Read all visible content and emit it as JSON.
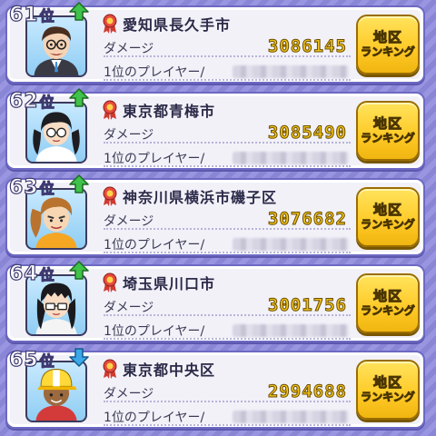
{
  "ranking": {
    "damage_label": "ダメージ",
    "top_player_label": "1位のプレイヤー/",
    "button_line1": "地区",
    "button_line2": "ランキング",
    "rank_suffix": "位",
    "entries": [
      {
        "rank": "61",
        "trend": "up",
        "location": "愛知県長久手市",
        "damage": "3086145",
        "avatar": "glasses-man"
      },
      {
        "rank": "62",
        "trend": "up",
        "location": "東京都青梅市",
        "damage": "3085490",
        "avatar": "twin-tail-girl"
      },
      {
        "rank": "63",
        "trend": "up",
        "location": "神奈川県横浜市磯子区",
        "damage": "3076682",
        "avatar": "ponytail-girl"
      },
      {
        "rank": "64",
        "trend": "up",
        "location": "埼玉県川口市",
        "damage": "3001756",
        "avatar": "glasses-girl"
      },
      {
        "rank": "65",
        "trend": "down",
        "location": "東京都中央区",
        "damage": "2994688",
        "avatar": "cap-boy"
      }
    ]
  },
  "colors": {
    "up_arrow": "#3fc24a",
    "down_arrow": "#3ba8e8",
    "damage_value": "#f3c318",
    "button": "#ffc926",
    "background": "#8a86d6"
  }
}
